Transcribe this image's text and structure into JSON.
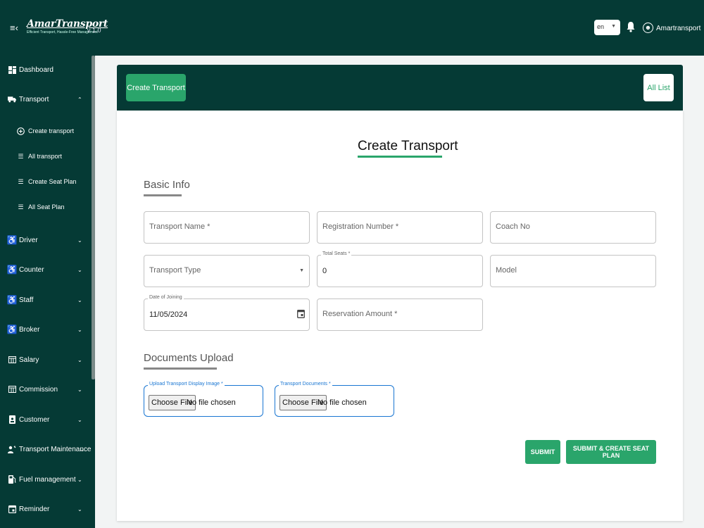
{
  "header": {
    "menu_icon": "menu-collapse-icon",
    "brand_name": "AmarTransport",
    "brand_tagline": "Efficient Transport, Hassle-Free Management",
    "version": "v 1.0",
    "language": "en",
    "user_name": "Amartransport"
  },
  "sidebar": {
    "items": [
      {
        "label": "Dashboard",
        "icon": "dashboard-icon"
      },
      {
        "label": "Transport",
        "icon": "truck-icon",
        "expanded": true
      },
      {
        "label": "Driver",
        "icon": "person-icon"
      },
      {
        "label": "Counter",
        "icon": "person-icon"
      },
      {
        "label": "Staff",
        "icon": "person-icon"
      },
      {
        "label": "Broker",
        "icon": "person-icon"
      },
      {
        "label": "Salary",
        "icon": "table-icon"
      },
      {
        "label": "Commission",
        "icon": "table-icon"
      },
      {
        "label": "Customer",
        "icon": "badge-icon"
      },
      {
        "label": "Transport Maintenance",
        "icon": "maintenance-icon"
      },
      {
        "label": "Fuel management",
        "icon": "fuel-icon"
      },
      {
        "label": "Reminder",
        "icon": "calendar-icon"
      }
    ],
    "transport_sub": [
      {
        "label": "Create transport",
        "icon": "add-circle-icon"
      },
      {
        "label": "All transport",
        "icon": "list-icon"
      },
      {
        "label": "Create Seat Plan",
        "icon": "list-icon"
      },
      {
        "label": "All Seat Plan",
        "icon": "list-icon"
      }
    ]
  },
  "card_header": {
    "create_btn": "Create Transport",
    "all_list_btn": "All List"
  },
  "form": {
    "title": "Create Transport",
    "basic_info_title": "Basic Info",
    "transport_name_placeholder": "Transport Name *",
    "registration_number_placeholder": "Registration Number *",
    "coach_no_placeholder": "Coach No",
    "transport_type_placeholder": "Transport Type",
    "total_seats_label": "Total Seats *",
    "total_seats_value": "0",
    "model_placeholder": "Model",
    "date_of_joining_label": "Date of Joining",
    "date_of_joining_value": "11/05/2024",
    "reservation_amount_placeholder": "Reservation Amount *",
    "documents_title": "Documents Upload",
    "display_image_label": "Upload Transport Display Image *",
    "documents_label": "Transport Documents *",
    "choose_file": "Choose File",
    "no_file": "No file chosen",
    "submit": "SUBMIT",
    "submit_seat": "SUBMIT & CREATE SEAT PLAN"
  },
  "colors": {
    "primary_dark": "#053a35",
    "accent_green": "#2aa56b",
    "focus_blue": "#1976d2"
  }
}
